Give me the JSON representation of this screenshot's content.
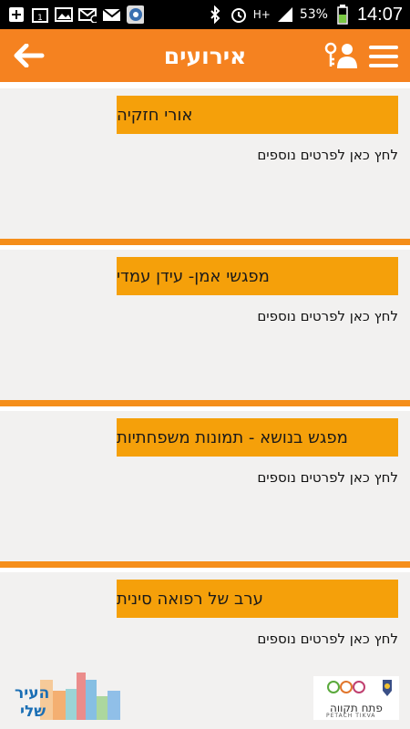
{
  "statusbar": {
    "battery_percent": "53%",
    "network": "H+",
    "time": "14:07",
    "icons": [
      "add-icon",
      "calendar-icon",
      "image-icon",
      "mail-icon",
      "gmail-icon",
      "camera-icon",
      "bluetooth-icon",
      "alarm-icon",
      "signal-icon",
      "battery-icon"
    ]
  },
  "appbar": {
    "title": "אירועים",
    "back_icon": "arrow-left-icon",
    "user_icon": "user-key-icon",
    "menu_icon": "hamburger-icon",
    "color": "#f58220"
  },
  "events": [
    {
      "title": "אורי חזקיה",
      "more": "לחץ כאן לפרטים נוספים"
    },
    {
      "title": "מפגשי אמן- עידן עמדי",
      "more": "לחץ כאן לפרטים נוספים"
    },
    {
      "title": "מפגש בנושא - תמונות משפחתיות",
      "more": "לחץ כאן לפרטים נוספים"
    },
    {
      "title": "ערב של רפואה סינית",
      "more": "לחץ כאן לפרטים נוספים"
    }
  ],
  "footer": {
    "left_logo_text": "העיר שלי",
    "right_logo_text": "פתח תקווה",
    "right_logo_sub": "PETACH TIKVA"
  },
  "colors": {
    "accent": "#f58220",
    "card_header": "#f5a00a",
    "card_bg": "#f2f1f0"
  }
}
